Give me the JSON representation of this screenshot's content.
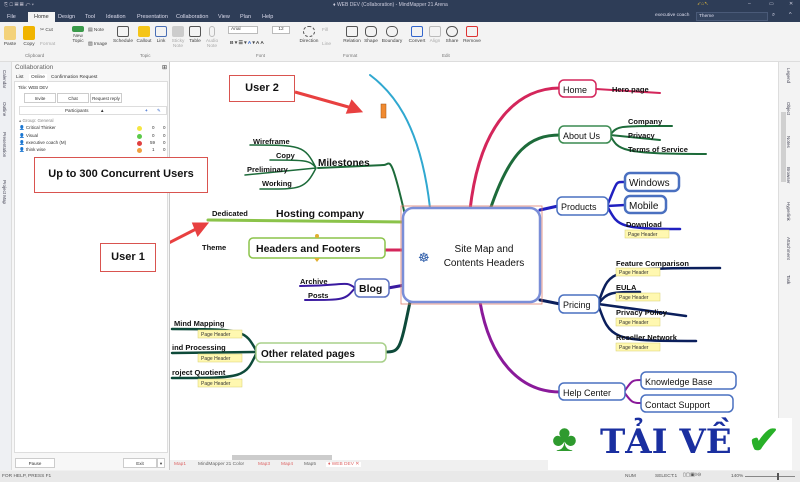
{
  "window": {
    "title": "♦ WEB DEV (Collaboration) - MindMapper 21 Arena",
    "user": "executive coach",
    "theme_input": "Theme"
  },
  "menu_tabs": [
    "File",
    "Home",
    "Design",
    "Tool",
    "Ideation",
    "Presentation",
    "Collaboration",
    "View",
    "Plan",
    "Help"
  ],
  "ribbon": {
    "buttons": [
      "Paste",
      "Copy",
      "Cut",
      "Format",
      "New Topic",
      "Note",
      "Image",
      "Schedule",
      "Callout",
      "Link",
      "Sticky Note",
      "Table",
      "Audio Note",
      "Direction",
      "Fill",
      "Line",
      "Relation",
      "Shape",
      "Boundary",
      "Convert",
      "Align",
      "Share",
      "Remove"
    ],
    "font": "Arial",
    "font_size": "12",
    "groups": [
      "Clipboard",
      "Topic",
      "Font",
      "Format",
      "Edit"
    ]
  },
  "left_strip": [
    "Calendar",
    "Outline",
    "Presentation",
    "Project Map"
  ],
  "collaboration": {
    "title": "Collaboration",
    "tabs": [
      "List",
      "Online",
      "Confirmation Request"
    ],
    "doc_title": "Title: WEB DEV",
    "buttons": [
      "Invite",
      "Chat",
      "Request reply"
    ],
    "participants_header": "Participants",
    "group": "Group: General",
    "participants": [
      {
        "name": "Critical Thinker",
        "status_color": "#f5e642",
        "a": "0",
        "b": "0"
      },
      {
        "name": "Visual",
        "status_color": "#5cc94a",
        "a": "0",
        "b": "0"
      },
      {
        "name": "executive coach (M)",
        "status_color": "#e04040",
        "a": "59",
        "b": "0"
      },
      {
        "name": "think wise",
        "status_color": "#f0a040",
        "a": "1",
        "b": "0"
      }
    ],
    "pause": "Pause",
    "exit": "Exit"
  },
  "right_strip": [
    "Legend",
    "Object",
    "Notes",
    "Browser",
    "Hyperlink",
    "Attachment",
    "Task"
  ],
  "callouts": {
    "user1": "User 1",
    "user2": "User 2",
    "concurrent": "Up to 300 Concurrent Users"
  },
  "mindmap": {
    "center": [
      "Site Map and",
      "Contents Headers"
    ],
    "page_header": "Page Header",
    "home": "Home",
    "hero": "Hero page",
    "about": "About Us",
    "about_items": [
      "Company",
      "Privacy",
      "Terms of Service"
    ],
    "products": "Products",
    "product_items": [
      "Windows",
      "Mobile",
      "Download"
    ],
    "pricing": "Pricing",
    "pricing_items": [
      "Feature Comparison",
      "EULA",
      "Privacy Policy",
      "Reseller Network"
    ],
    "help": "Help Center",
    "help_items": [
      "Knowledge Base",
      "Contact Support"
    ],
    "milestones": "Milestones",
    "milestone_items": [
      "Wireframe",
      "Copy",
      "Preliminary",
      "Working"
    ],
    "hosting": "Hosting company",
    "dedicated": "Dedicated",
    "headers": "Headers and Footers",
    "theme": "Theme",
    "blog": "Blog",
    "blog_items": [
      "Archive",
      "Posts"
    ],
    "other": "Other related pages",
    "other_items": [
      "Mind Mapping",
      "ind Processing",
      "roject Quotient"
    ]
  },
  "map_tabs": [
    "Map1",
    "MindMapper 21 Color",
    "Map3",
    "Map4",
    "Map5",
    "♦ WEB DEV"
  ],
  "status": {
    "help": "FOR HELP, PRESS F1",
    "num": "NUM",
    "select": "SELECT:1",
    "zoom": "140%"
  },
  "watermark": "TẢI VỀ",
  "colors": {
    "titlebar": "#2e3d57",
    "accent": "#4a6fb5",
    "callout_border": "#d9534f"
  }
}
